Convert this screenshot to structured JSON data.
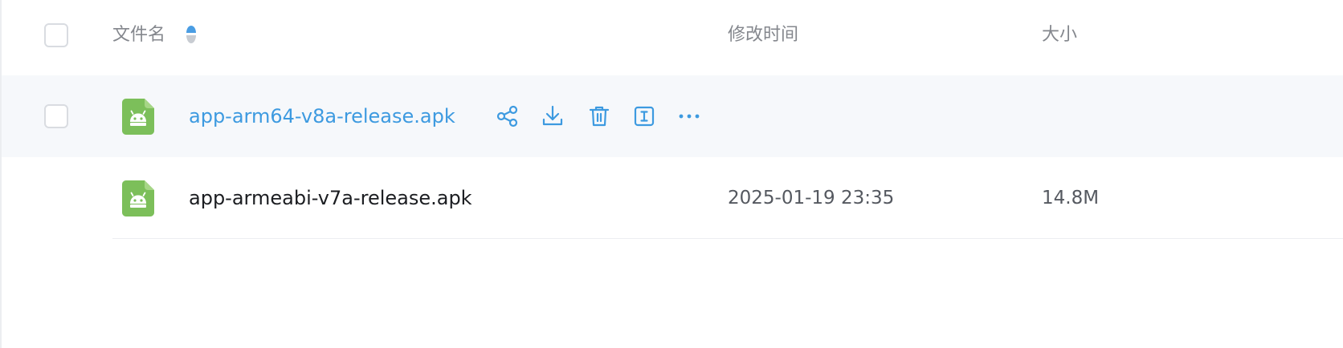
{
  "columns": {
    "name": "文件名",
    "modified": "修改时间",
    "size": "大小"
  },
  "sort": {
    "column": "name",
    "icon": "sort-icon",
    "colors": {
      "up": "#4a9de3",
      "down": "#c8ccd2"
    }
  },
  "files": [
    {
      "name": "app-arm64-v8a-release.apk",
      "modified": "",
      "size": "",
      "hovered": true,
      "icon": "android-apk-file-icon"
    },
    {
      "name": "app-armeabi-v7a-release.apk",
      "modified": "2025-01-19 23:35",
      "size": "14.8M",
      "hovered": false,
      "icon": "android-apk-file-icon"
    }
  ],
  "row_actions": [
    {
      "id": "share",
      "icon": "share-icon"
    },
    {
      "id": "download",
      "icon": "download-icon"
    },
    {
      "id": "delete",
      "icon": "trash-icon"
    },
    {
      "id": "rename",
      "icon": "rename-icon"
    },
    {
      "id": "more",
      "icon": "more-icon"
    }
  ],
  "colors": {
    "accent": "#3d9ae0",
    "apk_icon": "#7cbf5a",
    "hover_row": "#f6f8fb",
    "header_text": "#84878d"
  }
}
